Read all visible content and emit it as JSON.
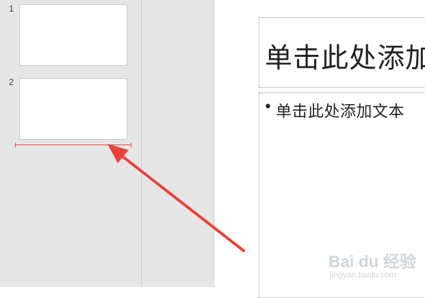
{
  "slides_panel": {
    "slides": [
      {
        "number": "1"
      },
      {
        "number": "2"
      }
    ]
  },
  "editor": {
    "title_placeholder": "单击此处添加",
    "body_bullet": "•",
    "body_placeholder": "单击此处添加文本"
  },
  "watermark": {
    "logo": "Bai du 经验",
    "url": "jingyan.baidu.com"
  },
  "colors": {
    "annotation_red": "#e8413b",
    "insert_line": "#d64a3b",
    "panel_gray": "#e6e6e6"
  },
  "icons": [
    "annotation-arrow-icon"
  ]
}
